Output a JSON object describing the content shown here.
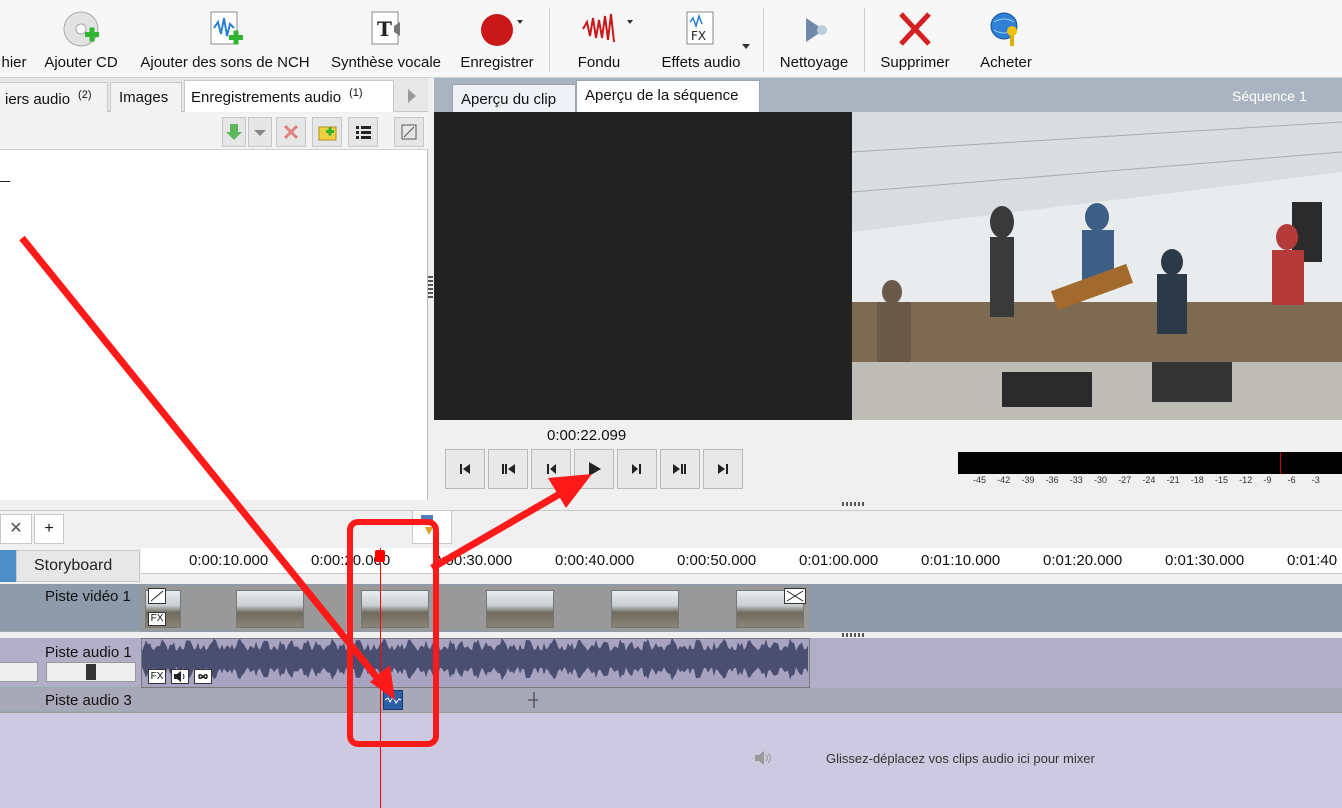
{
  "toolbar": {
    "items": [
      {
        "label": "hier"
      },
      {
        "label": "Ajouter CD"
      },
      {
        "label": "Ajouter des sons de NCH"
      },
      {
        "label": "Synthèse vocale"
      },
      {
        "label": "Enregistrer"
      },
      {
        "label": "Fondu"
      },
      {
        "label": "Effets audio"
      },
      {
        "label": "Nettoyage"
      },
      {
        "label": "Supprimer"
      },
      {
        "label": "Acheter"
      }
    ]
  },
  "left_panel": {
    "tabs": [
      {
        "label": "iers audio",
        "count": "(2)"
      },
      {
        "label": "Images",
        "count": ""
      },
      {
        "label": "Enregistrements audio",
        "count": "(1)"
      }
    ],
    "tools": [
      "download-icon",
      "dropdown-icon",
      "delete-icon",
      "folder-add-icon",
      "list-view-icon",
      "expand-icon"
    ]
  },
  "preview": {
    "tabs": [
      {
        "label": "Aperçu du clip"
      },
      {
        "label": "Aperçu de la séquence"
      }
    ],
    "sequence_label": "Séquence 1",
    "timecode": "0:00:22.099",
    "meter_ticks": [
      "-45",
      "-42",
      "-39",
      "-36",
      "-33",
      "-30",
      "-27",
      "-24",
      "-21",
      "-18",
      "-15",
      "-12",
      "-9",
      "-6",
      "-3"
    ]
  },
  "timeline": {
    "tab_close": "✕",
    "tab_add": "+",
    "storyboard": "Storyboard",
    "ruler": [
      "0:00:10.000",
      "0:00:20.000",
      "0:00:30.000",
      "0:00:40.000",
      "0:00:50.000",
      "0:01:00.000",
      "0:01:10.000",
      "0:01:20.000",
      "0:01:30.000",
      "0:01:40"
    ],
    "tracks": {
      "video1": "Piste vidéo 1",
      "audio1": "Piste audio 1",
      "audio3": "Piste audio 3"
    },
    "clip_badges": [
      "FX"
    ],
    "drop_hint": "Glissez-déplacez vos clips audio ici pour mixer"
  },
  "colors": {
    "annotation": "#ff1a1a",
    "playhead": "#ff0000"
  }
}
